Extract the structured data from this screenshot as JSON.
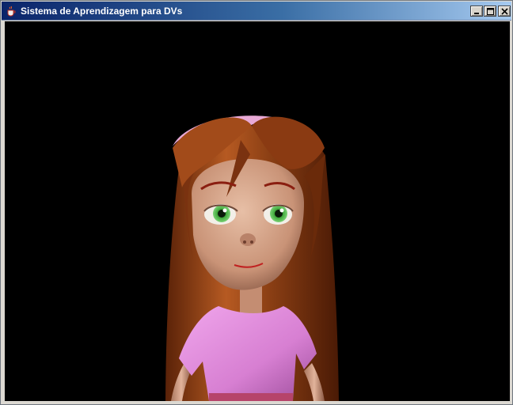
{
  "window": {
    "title": "Sistema de Aprendizagem para DVs",
    "app_icon": "java-cup-icon",
    "controls": {
      "minimize": "minimize-icon",
      "maximize": "maximize-icon",
      "close": "close-icon"
    }
  },
  "scene": {
    "background": "#000000",
    "character": "3d-girl-avatar",
    "colors": {
      "hair": "#8b3f14",
      "headband": "#e8a9d6",
      "skin": "#d7a98f",
      "eyes": "#3fa73a",
      "shirt": "#d77fd2"
    }
  }
}
